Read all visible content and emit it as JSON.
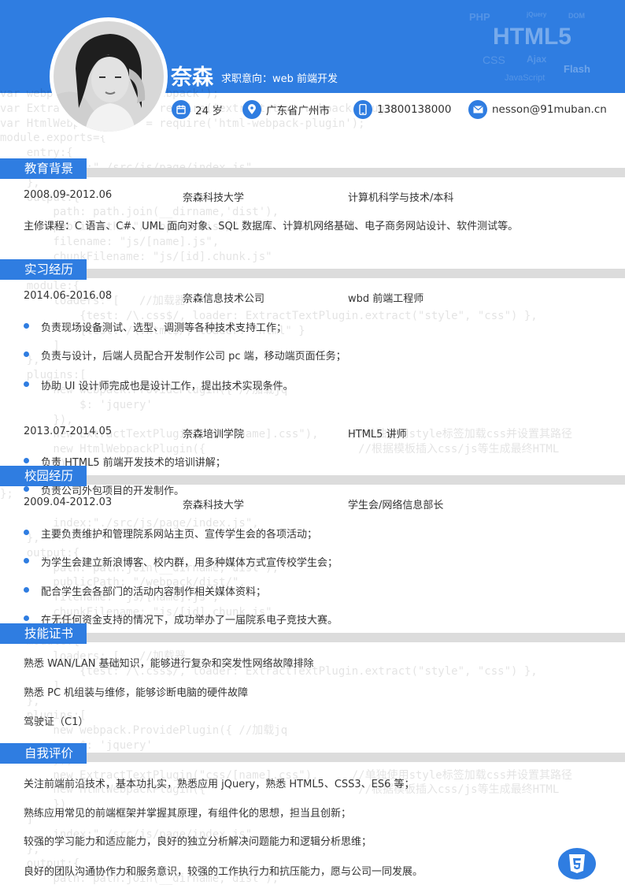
{
  "header": {
    "name": "奈森",
    "intent": "求职意向：web 前端开发",
    "watermarks": [
      "PHP",
      "jQuery",
      "DOM",
      "HTML5",
      "CSS",
      "Ajax",
      "Flash",
      "JavaScript"
    ],
    "age": "24 岁",
    "location": "广东省广州市",
    "phone": "13800138000",
    "email": "nesson@91muban.cn"
  },
  "education": {
    "title": "教育背景",
    "date": "2008.09-2012.06",
    "school": "奈森科技大学",
    "major": "计算机科学与技术/本科",
    "courses": "主修课程：C 语言、C#、UML 面向对象、SQL 数据库、计算机网络基础、电子商务网站设计、软件测试等。"
  },
  "experience": {
    "title": "实习经历",
    "jobs": [
      {
        "date": "2014.06-2016.08",
        "company": "奈森信息技术公司",
        "role": "wbd 前端工程师",
        "items": [
          "负责现场设备测试、选型、调测等各种技术支持工作；",
          "负责与设计，后端人员配合开发制作公司 pc 端，移动端页面任务；",
          "协助 UI 设计师完成也是设计工作，提出技术实现条件。"
        ]
      },
      {
        "date": "2013.07-2014.05",
        "company": "奈森培训学院",
        "role": "HTML5 讲师",
        "items": [
          "负责 HTML5 前端开发技术的培训讲解；",
          "负责公司外包项目的开发制作。"
        ]
      }
    ]
  },
  "campus": {
    "title": "校园经历",
    "date": "2009.04-2012.03",
    "school": "奈森科技大学",
    "role": "学生会/网络信息部长",
    "items": [
      "主要负责维护和管理院系网站主页、宣传学生会的各项活动；",
      "为学生会建立新浪博客、校内群，用多种媒体方式宣传校学生会；",
      "配合学生会各部门的活动内容制作相关媒体资料；",
      "在无任何资金支持的情况下，成功举办了一届院系电子竞技大赛。"
    ]
  },
  "skills": {
    "title": "技能证书",
    "items": [
      "熟悉 WAN/LAN 基础知识，能够进行复杂和突发性网络故障排除",
      "熟悉 PC 机组装与维修，能够诊断电脑的硬件故障",
      "驾驶证（C1）"
    ]
  },
  "self": {
    "title": "自我评价",
    "items": [
      "关注前端前沿技术，基本功扎实，熟悉应用 jQuery，熟悉 HTML5、CSS3、ES6 等；",
      "熟练应用常见的前端框架并掌握其原理，有组件化的思想，担当且创新；",
      "较强的学习能力和适应能力，良好的独立分析解决问题能力和逻辑分析思维；",
      "良好的团队沟通协作力和服务意识，较强的工作执行力和抗压能力，愿与公司一同发展。"
    ]
  },
  "code_lines": [
    "var webpack = require('webpack');",
    "var ExtractTextPlugin = require('extract-text-webpack-plugin');",
    "var HtmlWebpackPlugin = require('html-webpack-plugin');",
    "module.exports={",
    "    entry:{",
    "        index:\"./src/js/page/index.js\",",
    "    },",
    "    output:{",
    "        path: path.join(__dirname,'dist'),",
    "        publicPath: \"/webpack/dist/\",",
    "        filename: \"js/[name].js\",",
    "        chunkFilename: \"js/[id].chunk.js\"",
    "    },",
    "    module:{",
    "        loaders: [   //加载器",
    "            {test: /\\.css$/, loader: ExtractTextPlugin.extract(\"style\", \"css\") },",
    "            {test: /\\.html$/, loader: \"html\" }",
    "        ]",
    "    },",
    "    plugins:[",
    "        new webpack.ProvidePlugin({ //加载jq",
    "            $: 'jquery'",
    "        }),",
    "        new ExtractTextPlugin(\"css/[name].css\"),     //单独使用style标签加载css并设置其路径",
    "        new HtmlWebpackPlugin({                       //根据模板插入css/js等生成最终HTML",
    "        })",
    "    ]",
    "};",
    "",
    "        index:\"./src/js/page/index.js\",",
    "    },",
    "    output:{",
    "        path: path.join(__dirname,'dist'),",
    "        publicPath: \"/webpack/dist/\",",
    "        filename: \"js/[name].js\",",
    "        chunkFilename: \"js/[id].chunk.js\"",
    "    },",
    "    module:{",
    "        loaders: [   //加载器",
    "            {test: /\\.css$/, loader: ExtractTextPlugin.extract(\"style\", \"css\") },",
    "        ]",
    "    },",
    "    plugins:[",
    "        new webpack.ProvidePlugin({ //加载jq",
    "            $: 'jquery'",
    "        }),",
    "        new ExtractTextPlugin(\"css/[name].css\"),     //单独使用style标签加载css并设置其路径",
    "        new HtmlWebpackPlugin({                       //根据模板插入css/js等生成最终HTML",
    "        })",
    "    ]",
    "        index:\"./src/js/page/index.js\",",
    "    },",
    "    output:{",
    "        path: path.join(__dirname,'dist'),",
    "        publicPath: \"/webpack/dist/\",",
    "        filename: \"js/[name].js\",",
    "        chunkFilename: \"js/[id].chunk.js\"",
    "    },",
    "    module: {",
    "    }"
  ],
  "colors": {
    "accent": "#2f7de1",
    "divider": "#dcdcdc",
    "text": "#333333"
  },
  "icons": [
    "calendar-icon",
    "location-icon",
    "phone-icon",
    "email-icon",
    "html5-icon"
  ]
}
